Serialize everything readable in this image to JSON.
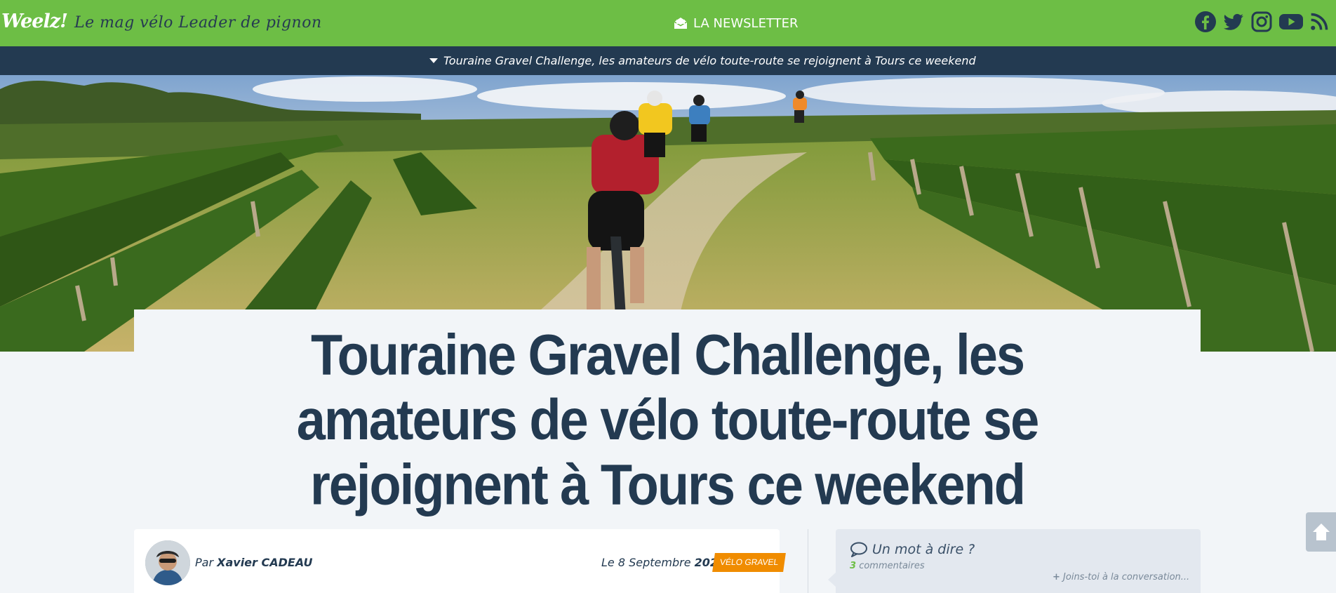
{
  "header": {
    "logo_text": "Weelz!",
    "tagline": "Le mag vélo Leader de pignon",
    "newsletter_label": "LA NEWSLETTER",
    "socials": [
      "facebook-icon",
      "twitter-icon",
      "instagram-icon",
      "youtube-icon",
      "rss-icon"
    ]
  },
  "breaking": {
    "text": "Touraine Gravel Challenge, les amateurs de vélo toute-route se rejoignent à Tours ce weekend"
  },
  "article": {
    "title_lines": [
      "Touraine Gravel Challenge, les",
      "amateurs de vélo toute-route se",
      "rejoignent à Tours ce weekend"
    ],
    "by_prefix": "Par",
    "author": "Xavier CADEAU",
    "date_prefix": "Le 8 Septembre",
    "year": "2023",
    "category": "VÉLO GRAVEL"
  },
  "comments": {
    "title": "Un mot à dire ?",
    "count": "3",
    "count_label": "commentaires",
    "join_label": "Joins-toi à la conversation..."
  },
  "colors": {
    "brand_green": "#6dbe45",
    "navy": "#233a51",
    "badge_orange": "#f08c00"
  }
}
